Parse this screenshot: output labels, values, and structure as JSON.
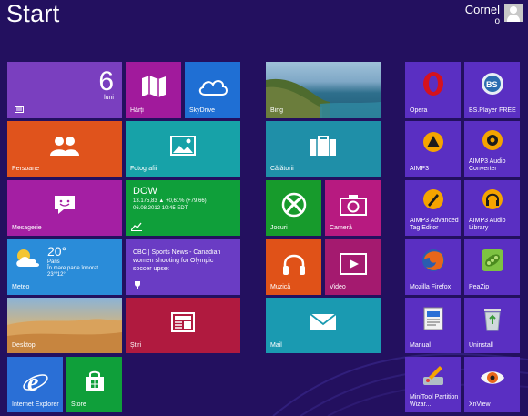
{
  "header": {
    "title": "Start",
    "user_name": "Cornel",
    "user_sub": "o"
  },
  "tiles": {
    "calendar": {
      "day_number": "6",
      "day_name": "luni"
    },
    "maps": {
      "label": "Hărți"
    },
    "skydrive": {
      "label": "SkyDrive"
    },
    "bing": {
      "label": "Bing"
    },
    "opera": {
      "label": "Opera"
    },
    "bsplayer": {
      "label": "BS.Player FREE"
    },
    "people": {
      "label": "Persoane"
    },
    "photos": {
      "label": "Fotografii"
    },
    "travel": {
      "label": "Călătorii"
    },
    "aimp3": {
      "label": "AIMP3"
    },
    "aimp_converter": {
      "label": "AIMP3 Audio Converter"
    },
    "messaging": {
      "label": "Mesagerie"
    },
    "finance": {
      "title": "DOW",
      "line1": "13.175,83 ▲ +0,61% (+79,66)",
      "line2": "06.08.2012 10:45 EDT"
    },
    "games": {
      "label": "Jocuri"
    },
    "camera": {
      "label": "Cameră"
    },
    "aimp_tag": {
      "label": "AIMP3 Advanced Tag Editor"
    },
    "aimp_library": {
      "label": "AIMP3 Audio Library"
    },
    "weather": {
      "label": "Meteo",
      "temp": "20°",
      "city": "Paris",
      "condition": "În mare parte înnorat",
      "range": "23°/12°"
    },
    "sports": {
      "text": "CBC | Sports News - Canadian women shooting for Olympic soccer upset"
    },
    "music": {
      "label": "Muzică"
    },
    "video": {
      "label": "Video"
    },
    "firefox": {
      "label": "Mozilla Firefox"
    },
    "peazip": {
      "label": "PeaZip"
    },
    "desktop": {
      "label": "Desktop"
    },
    "news": {
      "label": "Știri"
    },
    "mail": {
      "label": "Mail"
    },
    "manual": {
      "label": "Manual"
    },
    "uninstall": {
      "label": "Uninstall"
    },
    "ie": {
      "label": "Internet Explorer"
    },
    "store": {
      "label": "Store"
    },
    "minitool": {
      "label": "MiniTool Partition Wizar..."
    },
    "xnview": {
      "label": "XnView"
    }
  },
  "colors": {
    "background": "#23105f",
    "calendar": "#7a3fbf",
    "maps": "#a11a9c",
    "skydrive": "#1f6fd4",
    "people": "#e0531c",
    "photos": "#17a2a8",
    "travel": "#1f8fa8",
    "messaging": "#a41fa3",
    "finance": "#0f9f3a",
    "games": "#179b2c",
    "camera": "#b71a80",
    "weather": "#2a8cd9",
    "sports": "#6a3cc4",
    "music": "#e05218",
    "video": "#a41a6f",
    "news": "#b01a3f",
    "mail": "#1a9ab1",
    "ie": "#2a6fd6",
    "store": "#0f9f3a",
    "desktop_tile": "#e6b56a",
    "app_tile": "#5a2fc2"
  }
}
